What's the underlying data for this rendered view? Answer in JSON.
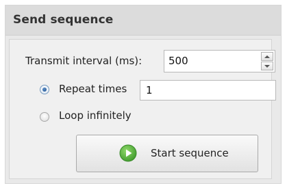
{
  "panel": {
    "title": "Send sequence"
  },
  "interval": {
    "label": "Transmit interval (ms):",
    "value": "500"
  },
  "repeat": {
    "label": "Repeat times",
    "value": "1",
    "selected": true
  },
  "loop": {
    "label": "Loop infinitely",
    "selected": false
  },
  "start_button": {
    "label": "Start sequence",
    "icon": "play-icon",
    "icon_color": "#4caf3a"
  }
}
